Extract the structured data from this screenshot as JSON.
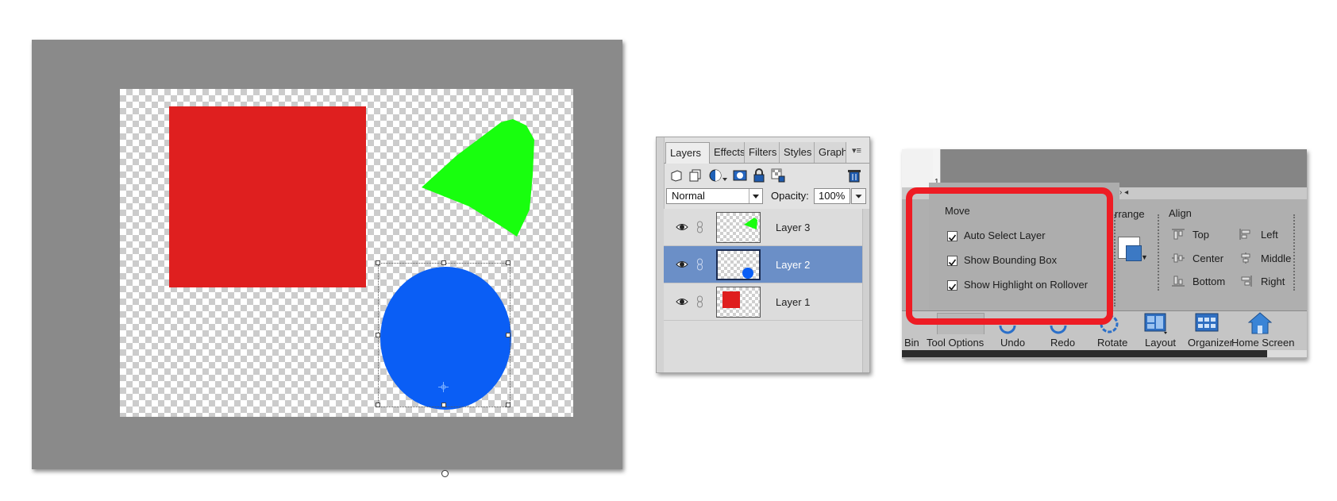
{
  "layers_panel": {
    "tabs": [
      "Layers",
      "Effects",
      "Filters",
      "Styles",
      "Graphics"
    ],
    "blend_mode": "Normal",
    "opacity_label": "Opacity:",
    "opacity_value": "100%",
    "layers": [
      {
        "name": "Layer 3",
        "selected": false
      },
      {
        "name": "Layer 2",
        "selected": true
      },
      {
        "name": "Layer 1",
        "selected": false
      }
    ]
  },
  "tool_options": {
    "ruler_number": "1",
    "move_section": {
      "title": "Move",
      "options": [
        {
          "label": "Auto Select Layer",
          "checked": true
        },
        {
          "label": "Show Bounding Box",
          "checked": true
        },
        {
          "label": "Show Highlight on Rollover",
          "checked": true
        }
      ]
    },
    "arrange_label": "rrange",
    "align": {
      "title": "Align",
      "items": [
        "Top",
        "Center",
        "Bottom",
        "Left",
        "Middle",
        "Right"
      ]
    },
    "bottom_buttons": [
      "Bin",
      "Tool Options",
      "Undo",
      "Redo",
      "Rotate",
      "Layout",
      "Organizer",
      "Home Screen"
    ]
  },
  "colors": {
    "red_shape": "#df1f1f",
    "green_shape": "#18ff0e",
    "blue_shape": "#0a5ef5",
    "highlight": "#ee1c24",
    "selected_layer": "#6b8fc7"
  },
  "icons": [
    "eye-icon",
    "link-icon",
    "new-layer-icon",
    "duplicate-layer-icon",
    "adjustment-layer-icon",
    "mask-icon",
    "lock-icon",
    "lock-transparency-icon",
    "trash-icon",
    "panel-menu-icon",
    "align-top-icon",
    "align-center-icon",
    "align-bottom-icon",
    "align-left-icon",
    "align-middle-icon",
    "align-right-icon",
    "undo-icon",
    "redo-icon",
    "rotate-icon",
    "layout-icon",
    "organizer-icon",
    "home-icon"
  ]
}
